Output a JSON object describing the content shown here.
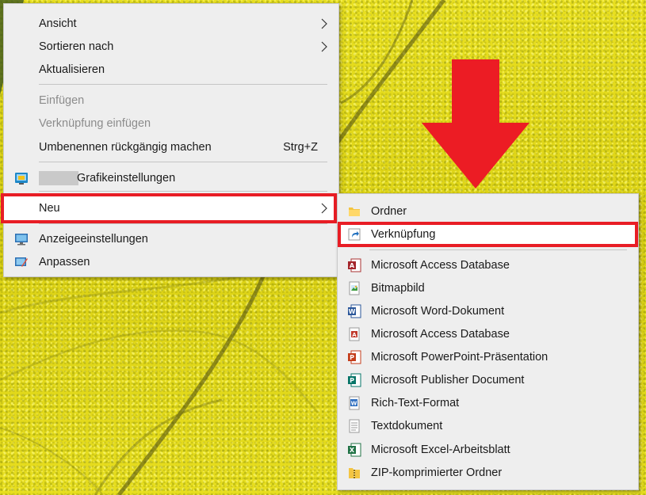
{
  "colors": {
    "menu_bg": "#eeeeee",
    "highlight_red": "#e81d25",
    "arrow_red": "#ec1c24",
    "disabled_text": "#8c8c8c",
    "field_yellow": "#e6dd1b"
  },
  "context_menu": {
    "items": [
      {
        "label": "Ansicht",
        "has_submenu": true
      },
      {
        "label": "Sortieren nach",
        "has_submenu": true
      },
      {
        "label": "Aktualisieren"
      },
      {
        "label": "Einfügen",
        "disabled": true
      },
      {
        "label": "Verknüpfung einfügen",
        "disabled": true
      },
      {
        "label": "Umbenennen rückgängig machen",
        "shortcut": "Strg+Z"
      },
      {
        "label": "Grafikeinstellungen",
        "icon": "graphics-settings-icon"
      },
      {
        "label": "Neu",
        "has_submenu": true,
        "highlighted": true
      },
      {
        "label": "Anzeigeeinstellungen",
        "icon": "display-settings-icon"
      },
      {
        "label": "Anpassen",
        "icon": "personalize-icon"
      }
    ]
  },
  "new_submenu": {
    "items": [
      {
        "label": "Ordner",
        "icon": "folder-icon"
      },
      {
        "label": "Verknüpfung",
        "icon": "shortcut-icon",
        "highlighted": true
      },
      {
        "label": "Microsoft Access Database",
        "icon": "access-icon"
      },
      {
        "label": "Bitmapbild",
        "icon": "bitmap-icon"
      },
      {
        "label": "Microsoft Word-Dokument",
        "icon": "word-icon"
      },
      {
        "label": "Microsoft Access Database",
        "icon": "access-icon"
      },
      {
        "label": "Microsoft PowerPoint-Präsentation",
        "icon": "powerpoint-icon"
      },
      {
        "label": "Microsoft Publisher Document",
        "icon": "publisher-icon"
      },
      {
        "label": "Rich-Text-Format",
        "icon": "wordpad-icon"
      },
      {
        "label": "Textdokument",
        "icon": "text-document-icon"
      },
      {
        "label": "Microsoft Excel-Arbeitsblatt",
        "icon": "excel-icon"
      },
      {
        "label": "ZIP-komprimierter Ordner",
        "icon": "zip-folder-icon"
      }
    ]
  }
}
